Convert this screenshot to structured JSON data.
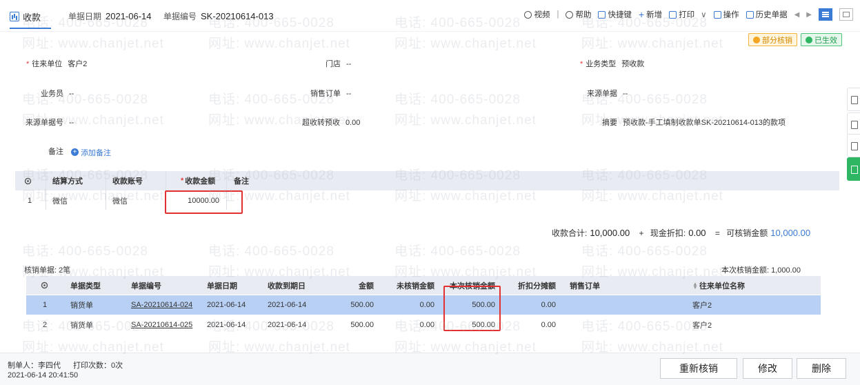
{
  "header": {
    "tab_label": "收款",
    "date_label": "单据日期",
    "date_value": "2021-06-14",
    "code_label": "单据编号",
    "code_value": "SK-20210614-013"
  },
  "toolbar": {
    "video": "视频",
    "divider": "|",
    "help": "帮助",
    "shortcut": "快捷键",
    "add": "新增",
    "print": "打印",
    "print_caret": "∨",
    "operate": "操作",
    "history": "历史单据"
  },
  "status": {
    "partial": "部分核销",
    "effective": "已生效"
  },
  "form": {
    "partner_label": "往来单位",
    "partner_value": "客户2",
    "store_label": "门店",
    "store_value": "--",
    "biz_type_label": "业务类型",
    "biz_type_value": "预收款",
    "salesman_label": "业务员",
    "salesman_value": "--",
    "sales_order_label": "销售订单",
    "sales_order_value": "--",
    "source_doc_label": "来源单据",
    "source_doc_value": "--",
    "source_no_label": "来源单据号",
    "source_no_value": "--",
    "over_label": "超收转预收",
    "over_value": "0.00",
    "summary_label": "摘要",
    "summary_value": "预收款-手工填制收款单SK-20210614-013的款项",
    "note_label": "备注",
    "add_note": "添加备注"
  },
  "payment_table": {
    "headers": [
      "结算方式",
      "收款账号",
      "收款金额",
      "备注"
    ],
    "rows": [
      {
        "idx": "1",
        "method": "微信",
        "account": "微信",
        "amount": "10000.00",
        "note": ""
      }
    ]
  },
  "totals": {
    "receipt_label": "收款合计:",
    "receipt_value": "10,000.00",
    "plus": "+",
    "discount_label": "现金折扣:",
    "discount_value": "0.00",
    "eq": "=",
    "writeoff_label": "可核销金额",
    "writeoff_value": "10,000.00"
  },
  "writeoff": {
    "count_label": "核销单据: 2笔",
    "this_amount_label": "本次核销金额: 1,000.00",
    "headers": [
      "单据类型",
      "单据编号",
      "单据日期",
      "收款到期日",
      "金额",
      "未核销金额",
      "本次核销金额",
      "折扣分摊额",
      "销售订单",
      "往来单位名称"
    ],
    "rows": [
      {
        "idx": "1",
        "type": "销货单",
        "code": "SA-20210614-024",
        "date": "2021-06-14",
        "due": "2021-06-14",
        "amount": "500.00",
        "unwritten": "0.00",
        "this": "500.00",
        "discount": "0.00",
        "order": "",
        "partner": "客户2"
      },
      {
        "idx": "2",
        "type": "销货单",
        "code": "SA-20210614-025",
        "date": "2021-06-14",
        "due": "2021-06-14",
        "amount": "500.00",
        "unwritten": "0.00",
        "this": "500.00",
        "discount": "0.00",
        "order": "",
        "partner": "客户2"
      }
    ]
  },
  "footer": {
    "maker": "制单人：李四代",
    "print_count": "打印次数：0次",
    "timestamp": "2021-06-14 20:41:50",
    "rewrite_btn": "重新核销",
    "edit_btn": "修改",
    "delete_btn": "删除"
  },
  "watermark": {
    "phone": "电话: 400-665-0028",
    "site": "网址: www.chanjet.net"
  },
  "colors": {
    "accent": "#3a7bd5",
    "highlight": "#e23030",
    "selected_row": "#b7d0f3"
  }
}
